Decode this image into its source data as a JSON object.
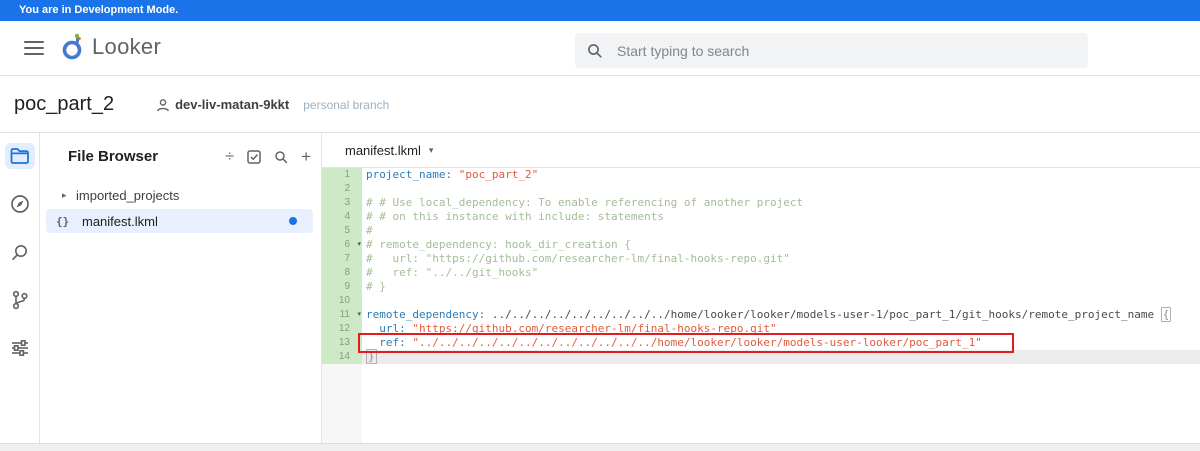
{
  "banner": {
    "text": "You are in Development Mode."
  },
  "header": {
    "logo_text": "Looker",
    "search_placeholder": "Start typing to search"
  },
  "project": {
    "title": "poc_part_2",
    "branch_name": "dev-liv-matan-9kkt",
    "branch_type": "personal branch"
  },
  "icons": {
    "caret_right": "▸",
    "caret_down": "▾",
    "divide": "÷",
    "plus": "+",
    "braces": "{}"
  },
  "file_browser": {
    "title": "File Browser",
    "items": [
      {
        "label": "imported_projects",
        "type": "folder-collapsed"
      },
      {
        "label": "manifest.lkml",
        "type": "lkml-file",
        "selected": true,
        "modified": true
      }
    ]
  },
  "editor": {
    "tab_label": "manifest.lkml",
    "lines": [
      {
        "num": 1,
        "segments": [
          {
            "c": "key",
            "t": "project_name:"
          },
          {
            "c": "plain",
            "t": " "
          },
          {
            "c": "str",
            "t": "\"poc_part_2\""
          }
        ]
      },
      {
        "num": 2,
        "segments": []
      },
      {
        "num": 3,
        "segments": [
          {
            "c": "com",
            "t": "# # Use local_dependency: To enable referencing of another project"
          }
        ]
      },
      {
        "num": 4,
        "segments": [
          {
            "c": "com",
            "t": "# # on this instance with include: statements"
          }
        ]
      },
      {
        "num": 5,
        "segments": [
          {
            "c": "com",
            "t": "#"
          }
        ]
      },
      {
        "num": 6,
        "fold": true,
        "segments": [
          {
            "c": "com",
            "t": "# remote_dependency: hook_dir_creation {"
          }
        ]
      },
      {
        "num": 7,
        "segments": [
          {
            "c": "com",
            "t": "#   url: \"https://github.com/researcher-lm/final-hooks-repo.git\""
          }
        ]
      },
      {
        "num": 8,
        "segments": [
          {
            "c": "com",
            "t": "#   ref: \"../../git_hooks\""
          }
        ]
      },
      {
        "num": 9,
        "segments": [
          {
            "c": "com",
            "t": "# }"
          }
        ]
      },
      {
        "num": 10,
        "segments": []
      },
      {
        "num": 11,
        "fold": true,
        "segments": [
          {
            "c": "key",
            "t": "remote_dependency:"
          },
          {
            "c": "plain",
            "t": " ../../../../../../../../../home/looker/looker/models-user-1/poc_part_1/git_hooks/remote_project_name "
          },
          {
            "c": "brace",
            "t": "{"
          }
        ]
      },
      {
        "num": 12,
        "segments": [
          {
            "c": "plain",
            "t": "  "
          },
          {
            "c": "key",
            "t": "url:"
          },
          {
            "c": "plain",
            "t": " "
          },
          {
            "c": "str",
            "t": "\"https://github.com/researcher-lm/final-hooks-repo.git\""
          }
        ]
      },
      {
        "num": 13,
        "red_box": true,
        "segments": [
          {
            "c": "plain",
            "t": "  "
          },
          {
            "c": "key",
            "t": "ref:"
          },
          {
            "c": "plain",
            "t": " "
          },
          {
            "c": "str",
            "t": "\"../../../../../../../../../../../../home/looker/looker/models-user-looker/poc_part_1\""
          }
        ]
      },
      {
        "num": 14,
        "active": true,
        "segments": [
          {
            "c": "brace",
            "t": "}"
          }
        ]
      }
    ]
  },
  "colors": {
    "accent": "#1a73e8",
    "added_gutter": "#cde9c6",
    "annotation_red": "#e11d1d",
    "selection_blue": "#e8f0fe"
  }
}
